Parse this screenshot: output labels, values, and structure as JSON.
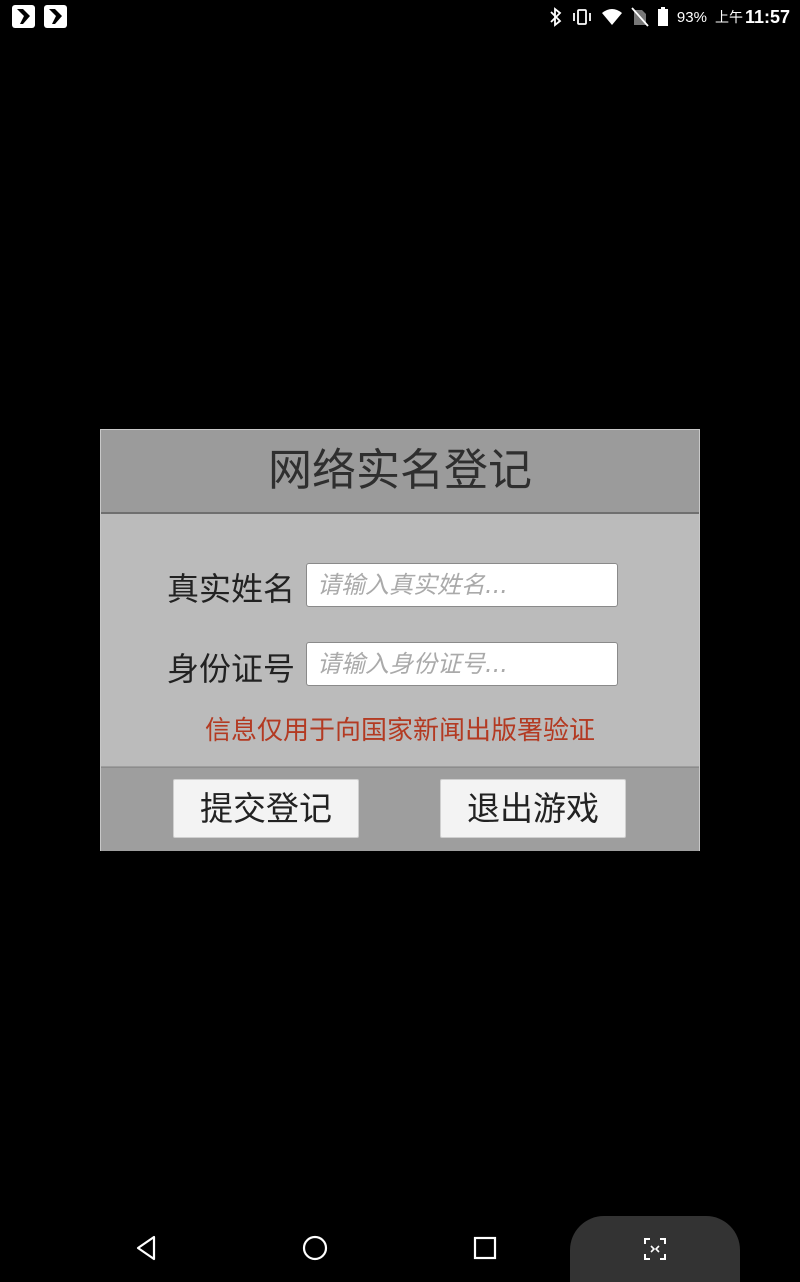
{
  "status_bar": {
    "battery": "93%",
    "time_prefix": "上午",
    "time": "11:57"
  },
  "dialog": {
    "title": "网络实名登记",
    "name_label": "真实姓名",
    "name_placeholder": "请输入真实姓名...",
    "id_label": "身份证号",
    "id_placeholder": "请输入身份证号...",
    "notice": "信息仅用于向国家新闻出版署验证",
    "submit_label": "提交登记",
    "exit_label": "退出游戏"
  },
  "colors": {
    "notice": "#b33a22",
    "header_bg": "#9b9b9b",
    "body_bg": "#bbbbbb"
  }
}
